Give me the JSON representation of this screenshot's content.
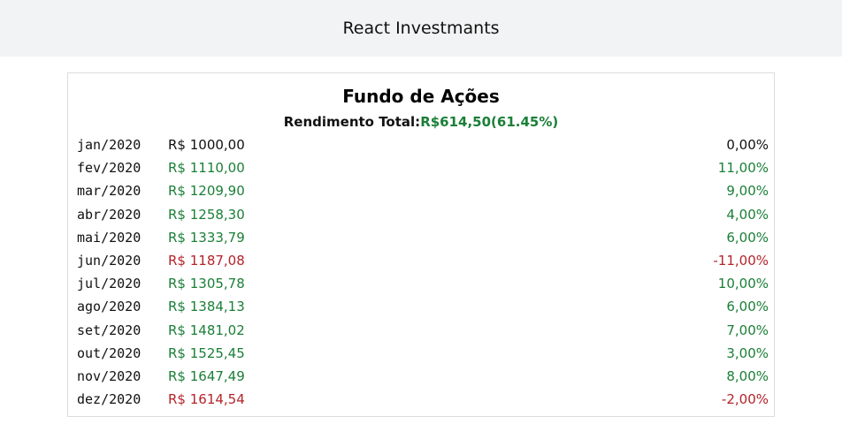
{
  "header": {
    "title": "React Investmants"
  },
  "fund": {
    "title": "Fundo de Ações",
    "summary_label": "Rendimento Total:",
    "summary_value": "R$614,50(61.45%)",
    "rows": [
      {
        "month": "jan/2020",
        "value": "R$ 1000,00",
        "pct": "0,00%",
        "trend": "neutral"
      },
      {
        "month": "fev/2020",
        "value": "R$ 1110,00",
        "pct": "11,00%",
        "trend": "pos"
      },
      {
        "month": "mar/2020",
        "value": "R$ 1209,90",
        "pct": "9,00%",
        "trend": "pos"
      },
      {
        "month": "abr/2020",
        "value": "R$ 1258,30",
        "pct": "4,00%",
        "trend": "pos"
      },
      {
        "month": "mai/2020",
        "value": "R$ 1333,79",
        "pct": "6,00%",
        "trend": "pos"
      },
      {
        "month": "jun/2020",
        "value": "R$ 1187,08",
        "pct": "-11,00%",
        "trend": "neg"
      },
      {
        "month": "jul/2020",
        "value": "R$ 1305,78",
        "pct": "10,00%",
        "trend": "pos"
      },
      {
        "month": "ago/2020",
        "value": "R$ 1384,13",
        "pct": "6,00%",
        "trend": "pos"
      },
      {
        "month": "set/2020",
        "value": "R$ 1481,02",
        "pct": "7,00%",
        "trend": "pos"
      },
      {
        "month": "out/2020",
        "value": "R$ 1525,45",
        "pct": "3,00%",
        "trend": "pos"
      },
      {
        "month": "nov/2020",
        "value": "R$ 1647,49",
        "pct": "8,00%",
        "trend": "pos"
      },
      {
        "month": "dez/2020",
        "value": "R$ 1614,54",
        "pct": "-2,00%",
        "trend": "neg"
      }
    ]
  },
  "colors": {
    "positive": "#1a7f37",
    "negative": "#b4232a",
    "neutral": "#111111",
    "header_bg": "#f2f3f4"
  }
}
